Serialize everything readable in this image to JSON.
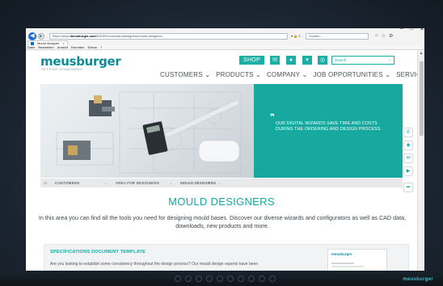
{
  "browser": {
    "url_prefix": "https://www.",
    "url_domain": "meusburger.com",
    "url_rest": "/EN/DE/customers/designers/mould-designers",
    "url_controls": "▾ 🔒 C",
    "search_placeholder": "Suchen...",
    "tab_title": "Mould designer",
    "tab_close": "×",
    "window_controls": [
      "–",
      "□",
      "✕"
    ],
    "menu": [
      "Datei",
      "Bearbeiten",
      "Ansicht",
      "Favoriten",
      "Extras",
      "?"
    ]
  },
  "site": {
    "logo": "meusburger",
    "tagline": "SETTING STANDARDS",
    "shop_label": "SHOP",
    "search_placeholder": "Search",
    "nav": [
      "CUSTOMERS ⌄",
      "PRODUCTS ⌄",
      "COMPANY ⌄",
      "JOB OPPORTUNITIES ⌄",
      "SERVICE ⌄"
    ]
  },
  "hero": {
    "quote": "❞",
    "text": "OUR DIGITAL WIZARDS SAVE TIME AND COSTS DURING THE ORDERING AND DESIGN PROCESS."
  },
  "breadcrumb": [
    "CUSTOMERS",
    "AREA FOR DESIGNERS",
    "MOULD DESIGNERS"
  ],
  "content": {
    "title": "MOULD DESIGNERS",
    "intro": "In this area you can find all the tools you need for designing mould bases. Discover our diverse wizards and configurators as well as CAD data, downloads, new products and more.",
    "card_title": "SPECIFICATIONS DOCUMENT TEMPLATE",
    "card_text": "Are you looking to establish some consistency throughout the design process? Our mould design experts have been",
    "card_thumb_logo": "meusburger"
  },
  "monitor": {
    "brand": "meusburger"
  },
  "colors": {
    "accent": "#17a99f",
    "logo": "#0d8c98",
    "text": "#3d4549"
  }
}
